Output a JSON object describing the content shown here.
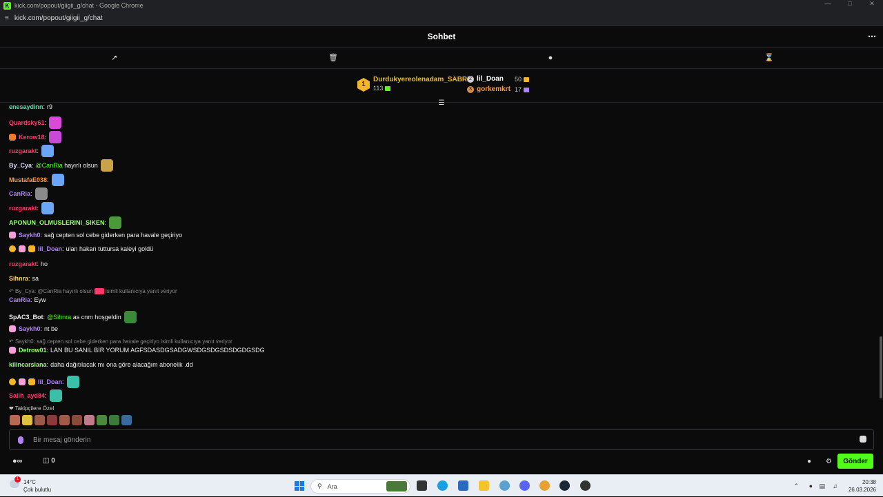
{
  "browser": {
    "title": "kick.com/popout/giigii_g/chat - Google Chrome",
    "url": "kick.com/popout/giigii_g/chat"
  },
  "chat": {
    "header": "Sohbet",
    "more_icon": "more-icon"
  },
  "tools": [
    "pin-icon",
    "trash-icon",
    "chat-bubble-icon",
    "hourglass-icon"
  ],
  "leaderboard": {
    "first": {
      "rank": "1",
      "name": "Durdukyereolenadam_SABRI",
      "count": "113"
    },
    "second": {
      "name": "lil_Doan",
      "count": "50"
    },
    "third": {
      "name": "gorkemkrt",
      "count": "17"
    }
  },
  "messages": [
    {
      "user": "enesaydinn",
      "color": "#53e0a8",
      "text": "r9"
    },
    {
      "user": "Quardsky61",
      "color": "#ff3b6b",
      "text": ""
    },
    {
      "user": "Kerow18",
      "color": "#ff3b6b",
      "text": ""
    },
    {
      "user": "ruzgarakt",
      "color": "#ff3b6b",
      "text": ""
    },
    {
      "user": "By_Cya",
      "color": "#dcdcff",
      "mention": "@CanRia",
      "text": "hayırlı olsun"
    },
    {
      "user": "MustafaE038",
      "color": "#ff9a3c",
      "text": ""
    },
    {
      "user": "CanRia",
      "color": "#b084f5",
      "text": ""
    },
    {
      "user": "ruzgarakt",
      "color": "#ff3b6b",
      "text": ""
    },
    {
      "user": "APONUN_OLMUSLERINI_SIKEN",
      "color": "#9cff7a",
      "text": ""
    },
    {
      "user": "Saykh0",
      "color": "#b084f5",
      "text": "sağ cepten sol cebe giderken para havale geçiriyo"
    },
    {
      "user": "lil_Doan",
      "color": "#b084f5",
      "text": "ulan hakan tuttursa kaleyi goldü"
    },
    {
      "user": "ruzgarakt",
      "color": "#ff3b6b",
      "text": "ho"
    },
    {
      "user": "Sihnra",
      "color": "#ffd27a",
      "text": "sa"
    },
    {
      "user": "CanRia",
      "color": "#b084f5",
      "text": "Eyw"
    },
    {
      "user": "SpAC3_Bot",
      "color": "#f0f0f0",
      "mention": "@Sihnra",
      "text": "as cnm hoşgeldin"
    },
    {
      "user": "Saykh0",
      "color": "#b084f5",
      "text": "nt be"
    },
    {
      "user": "Detrow01",
      "color": "#9cff7a",
      "text": "LAN BU SANIL BİR YORUM AGFSDASDGSADGWSDGSDGSDSDGDGSDG"
    },
    {
      "user": "kilincarslana",
      "color": "#9cff7a",
      "text": "daha dağıtılacak mı ona göre alacağım abonelik .dd"
    },
    {
      "user": "lil_Doan",
      "color": "#b084f5",
      "text": ""
    },
    {
      "user": "Salih_ayd84",
      "color": "#ff3b6b",
      "text": ""
    }
  ],
  "replies": [
    {
      "text": "By_Cya: @CanRia hayırlı olsun",
      "suffix": "isimli kullanıcıya yanıt veriyor"
    },
    {
      "text": "Saykh0: sağ cepten sol cebe giderken para havale geçiriyo isimli kullanıcıya yanıt veriyor"
    }
  ],
  "followers_label": "Takipçilere Özel",
  "input": {
    "placeholder": "Bir mesaj gönderin"
  },
  "bottom": {
    "count": "0",
    "send_label": "Gönder"
  },
  "taskbar": {
    "weather_temp": "14°C",
    "weather_desc": "Çok bulutlu",
    "weather_badge": "1",
    "search_label": "Ara",
    "time": "20:38",
    "date": "26.03.2026"
  },
  "colors": {
    "accent": "#53fc18",
    "gold": "#f5b728",
    "purple": "#b084f5"
  }
}
